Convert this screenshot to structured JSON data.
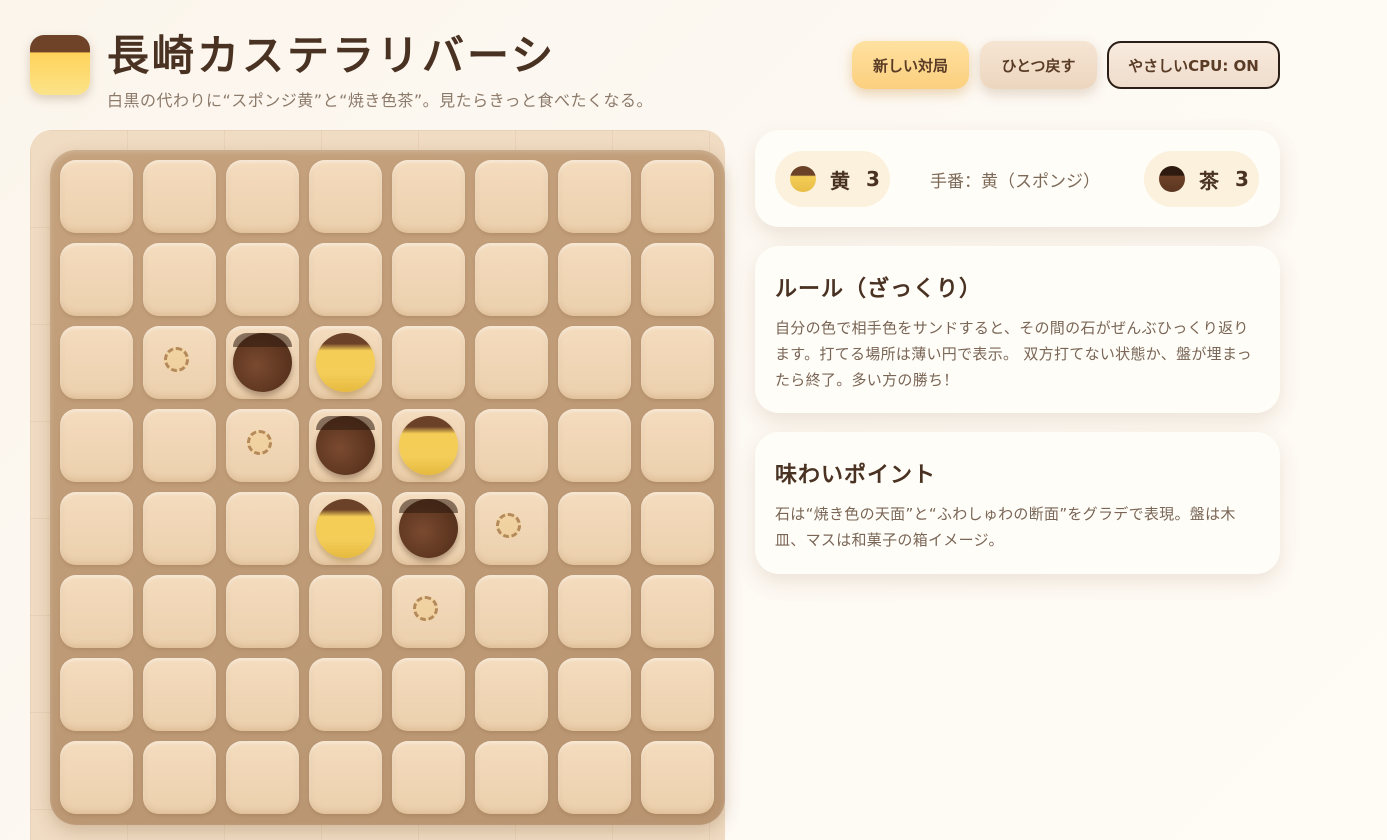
{
  "header": {
    "title": "長崎カステラリバーシ",
    "subtitle": "白黒の代わりに“スポンジ黄”と“焼き色茶”。見たらきっと食べたくなる。",
    "logo_icon": "castella-icon"
  },
  "toolbar": {
    "new_game_label": "新しい対局",
    "undo_label": "ひとつ戻す",
    "cpu_toggle_label": "やさしいCPU: ON"
  },
  "score": {
    "yellow_label": "黄",
    "yellow_count": "3",
    "brown_label": "茶",
    "brown_count": "3",
    "turn_text": "手番：黄（スポンジ）"
  },
  "rules": {
    "title": "ルール（ざっくり）",
    "text": "自分の色で相手色をサンドすると、その間の石がぜんぶひっくり返ります。打てる場所は薄い円で表示。 双方打てない状態か、盤が埋まったら終了。多い方の勝ち！"
  },
  "info": {
    "title": "味わいポイント",
    "text": "石は“焼き色の天面”と“ふわしゅわの断面”をグラデで表現。盤は木皿、マスは和菓子の箱イメージ。"
  },
  "board": {
    "size": 8,
    "cells": [
      [
        "",
        "",
        "",
        "",
        "",
        "",
        "",
        ""
      ],
      [
        "",
        "",
        "",
        "",
        "",
        "",
        "",
        ""
      ],
      [
        "",
        "h",
        "B",
        "Y",
        "",
        "",
        "",
        ""
      ],
      [
        "",
        "",
        "h",
        "B",
        "Y",
        "",
        "",
        ""
      ],
      [
        "",
        "",
        "",
        "Y",
        "B",
        "h",
        "",
        ""
      ],
      [
        "",
        "",
        "",
        "",
        "h",
        "",
        "",
        ""
      ],
      [
        "",
        "",
        "",
        "",
        "",
        "",
        "",
        ""
      ],
      [
        "",
        "",
        "",
        "",
        "",
        "",
        "",
        ""
      ]
    ],
    "legend": {
      "Y": "yellow",
      "B": "brown",
      "h": "hint"
    }
  },
  "colors": {
    "yellow": "#f3cd58",
    "brown": "#5e3620",
    "board": "#b89471",
    "cell": "#f0d5b3"
  }
}
